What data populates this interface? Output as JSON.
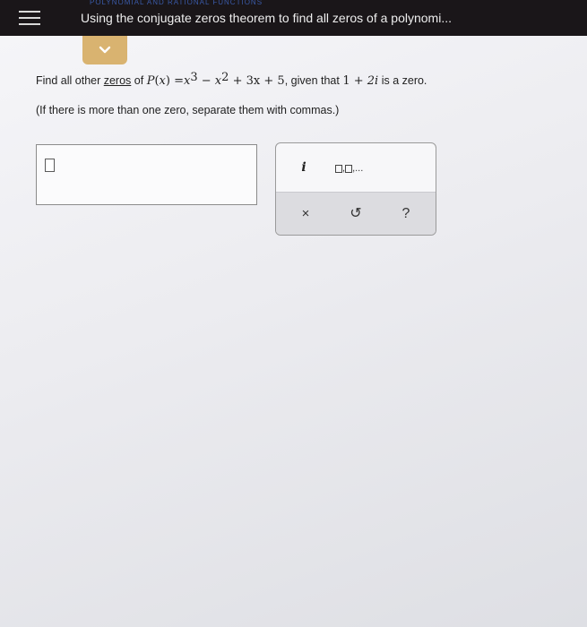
{
  "header": {
    "breadcrumb": "POLYNOMIAL AND RATIONAL FUNCTIONS",
    "title": "Using the conjugate zeros theorem to find all zeros of a polynomi..."
  },
  "question": {
    "find_all": "Find all other ",
    "zeros": "zeros",
    "of": " of ",
    "p": "P",
    "x": "x",
    "equals": "=",
    "exp3": "3",
    "exp2": "2",
    "minus": "−",
    "plus": "+",
    "three_x": "3x",
    "five": "5",
    "given_that": ", given that ",
    "one": "1",
    "two_i": "2i",
    "is_a_zero": " is a zero."
  },
  "instruction": "(If there is more than one zero, separate them with commas.)",
  "keypad": {
    "i_key": "i",
    "list_key_dots": "...",
    "clear_key": "×",
    "undo_key": "↺",
    "help_key": "?"
  },
  "colors": {
    "header_bg": "#1a1619",
    "collapse_tab": "#d9b370",
    "breadcrumb": "#3a5aa8"
  }
}
